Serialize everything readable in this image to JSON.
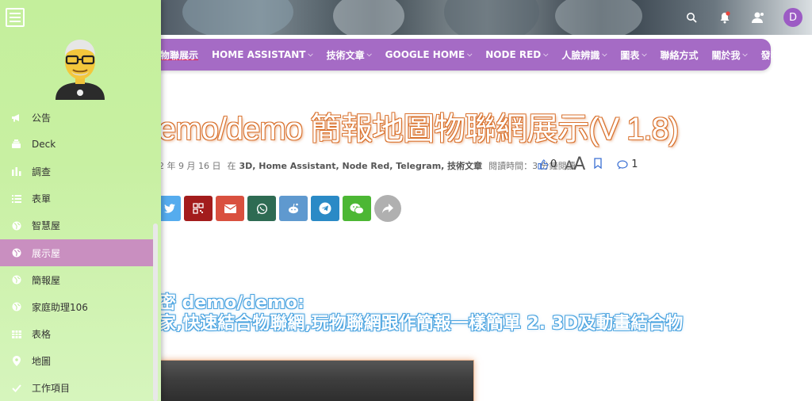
{
  "header": {
    "avatar_letter": "D"
  },
  "nav": {
    "items": [
      {
        "label": "物聯展示",
        "has_dropdown": false
      },
      {
        "label": "HOME ASSISTANT",
        "has_dropdown": true
      },
      {
        "label": "技術文章",
        "has_dropdown": true
      },
      {
        "label": "GOOGLE HOME",
        "has_dropdown": true
      },
      {
        "label": "NODE RED",
        "has_dropdown": true
      },
      {
        "label": "人臉辨識",
        "has_dropdown": true
      },
      {
        "label": "圖表",
        "has_dropdown": true
      },
      {
        "label": "聯絡方式",
        "has_dropdown": false
      },
      {
        "label": "關於我",
        "has_dropdown": true
      },
      {
        "label": "發表文章",
        "has_dropdown": false
      }
    ],
    "chevron": "⌵"
  },
  "post": {
    "title": "emo/demo 簡報地圖物聯網展示(V 1.8)",
    "date": "2 年 9 月 16 日",
    "in_label": "在",
    "categories": "3D, Home Assistant, Node Red, Telegram, 技術文章",
    "read_time": "閱讀時間：3 分鐘閱讀",
    "likes": "0",
    "comments": "1",
    "font_small": "A",
    "font_large": "A"
  },
  "content": {
    "line1": "密 demo/demo:",
    "line2": "家,快速結合物聯網,玩物聯網跟作簡報一樣簡單 2. 3D及動畫結合物"
  },
  "share": [
    {
      "name": "twitter",
      "color": "#55acee"
    },
    {
      "name": "qrcode",
      "color": "#a31c1c"
    },
    {
      "name": "email",
      "color": "#d9503f"
    },
    {
      "name": "whatsapp",
      "color": "#2e6b53"
    },
    {
      "name": "reddit",
      "color": "#5f99cf"
    },
    {
      "name": "telegram",
      "color": "#2a8ac6"
    },
    {
      "name": "wechat",
      "color": "#4cb734"
    }
  ],
  "sidebar": {
    "items": [
      {
        "label": "公告",
        "icon": "megaphone-icon",
        "active": false
      },
      {
        "label": "Deck",
        "icon": "deck-icon",
        "active": false
      },
      {
        "label": "調查",
        "icon": "bar-chart-icon",
        "active": false
      },
      {
        "label": "表單",
        "icon": "list-icon",
        "active": false
      },
      {
        "label": "智慧屋",
        "icon": "globe-icon",
        "active": false
      },
      {
        "label": "展示屋",
        "icon": "globe-icon",
        "active": true
      },
      {
        "label": "簡報屋",
        "icon": "globe-icon",
        "active": false
      },
      {
        "label": "家庭助理106",
        "icon": "globe-icon",
        "active": false
      },
      {
        "label": "表格",
        "icon": "table-icon",
        "active": false
      },
      {
        "label": "地圖",
        "icon": "map-pin-icon",
        "active": false
      },
      {
        "label": "工作項目",
        "icon": "check-icon",
        "active": false
      }
    ]
  },
  "colors": {
    "nav_bg": "#a56bc5",
    "sidebar_bg": "#c8f0a2",
    "sidebar_active": "#c98fc0",
    "title_outline": "#d9722e",
    "highlight_outline": "#4aa3e0",
    "meta_accent": "#3a6fd3"
  }
}
